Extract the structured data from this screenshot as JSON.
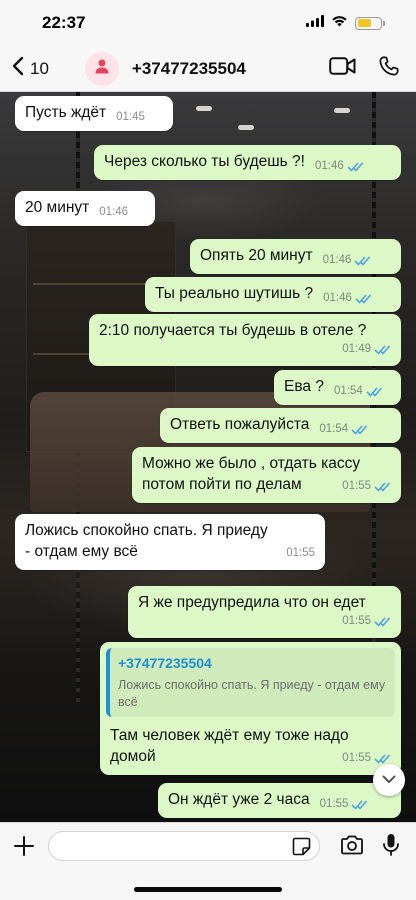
{
  "status_bar": {
    "time": "22:37"
  },
  "header": {
    "back_count": "10",
    "contact": "+37477235504"
  },
  "messages": [
    {
      "dir": "in",
      "text": "Пусть ждёт",
      "time": "01:45"
    },
    {
      "dir": "out",
      "text": "Через сколько ты будешь ?!",
      "time": "01:46",
      "status": "read"
    },
    {
      "dir": "in",
      "text": "20 минут",
      "time": "01:46"
    },
    {
      "dir": "out",
      "text": "Опять 20 минут",
      "time": "01:46",
      "status": "read"
    },
    {
      "dir": "out",
      "text": "Ты реально шутишь ?",
      "time": "01:46",
      "status": "read"
    },
    {
      "dir": "out",
      "text": "2:10 получается ты будешь в отеле ?",
      "time": "01:49",
      "status": "read"
    },
    {
      "dir": "out",
      "text": "Ева ?",
      "time": "01:54",
      "status": "read"
    },
    {
      "dir": "out",
      "text": "Ответь пожалуйста",
      "time": "01:54",
      "status": "read"
    },
    {
      "dir": "out",
      "text": "Можно же было , отдать кассу потом пойти по делам",
      "time": "01:55",
      "status": "read"
    },
    {
      "dir": "in",
      "text": "Ложись спокойно спать. Я приеду - отдам ему всё",
      "time": "01:55"
    },
    {
      "dir": "out",
      "text": "Я же предупредила что он едет",
      "time": "01:55",
      "status": "read"
    },
    {
      "dir": "out",
      "quote": {
        "name": "+37477235504",
        "text": "Ложись спокойно спать. Я приеду - отдам ему всё"
      },
      "text": "Там человек ждёт ему тоже надо домой",
      "time": "01:55",
      "status": "read"
    },
    {
      "dir": "out",
      "text": "Он ждёт уже 2 часа",
      "time": "01:55",
      "status": "read"
    }
  ],
  "colors": {
    "outgoing_bubble": "#dcf8c6",
    "incoming_bubble": "#ffffff",
    "read_ticks": "#4fa3e0",
    "quote_accent": "#1f8ed3",
    "battery": "#f3c623"
  },
  "icons": {
    "back": "chevron-left-icon",
    "avatar": "person-icon",
    "video": "video-camera-icon",
    "call": "phone-icon",
    "attach": "plus-icon",
    "sticker": "sticker-icon",
    "camera": "camera-icon",
    "mic": "microphone-icon",
    "scroll": "chevron-down-icon"
  }
}
